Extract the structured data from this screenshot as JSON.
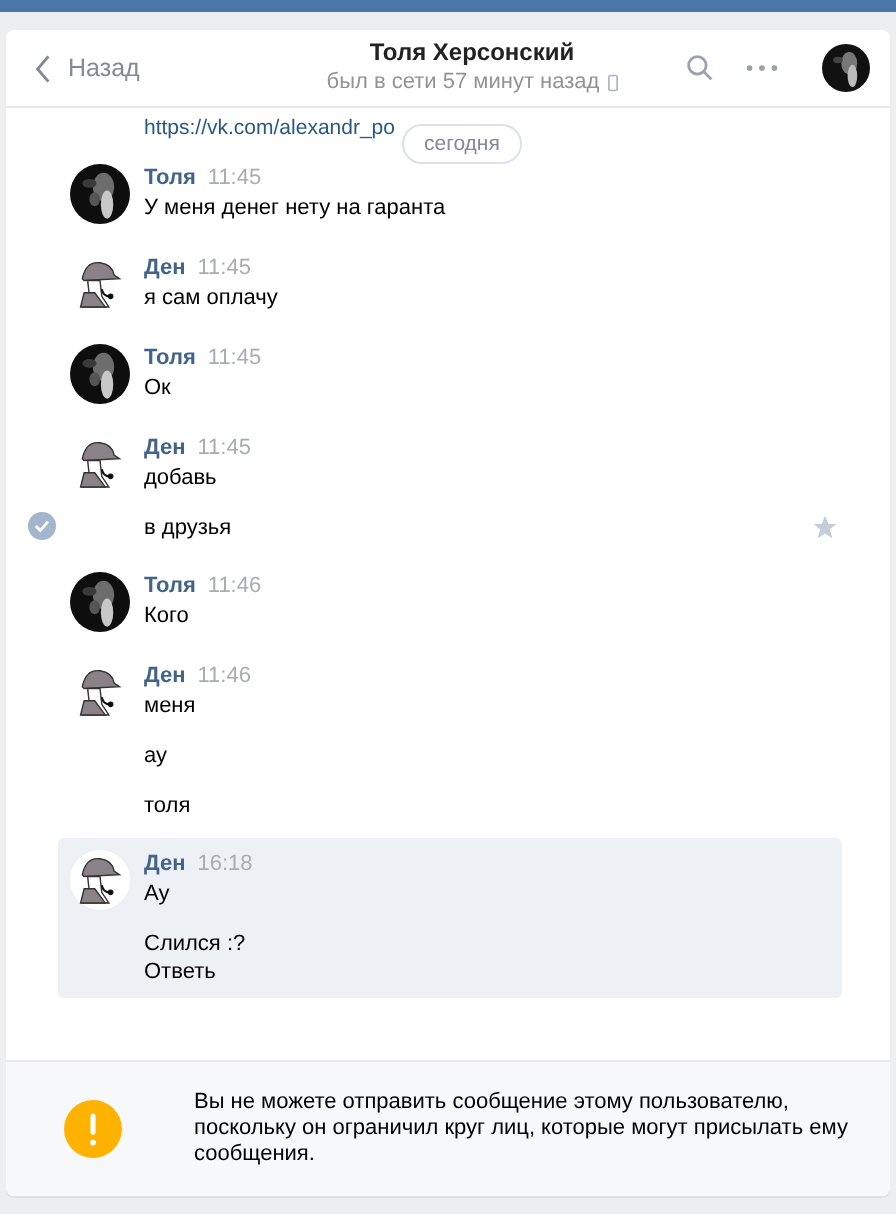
{
  "header": {
    "back": "Назад",
    "title": "Толя Херсонский",
    "status": "был в сети 57 минут назад"
  },
  "link": "https://vk.com/alexandr_po",
  "date_pill": "сегодня",
  "groups": [
    {
      "author": "Толя",
      "time": "11:45",
      "highlighted": false,
      "messages": [
        {
          "text": "У меня денег нету на гаранта",
          "selected": false
        }
      ]
    },
    {
      "author": "Ден",
      "time": "11:45",
      "kind": "detective",
      "highlighted": false,
      "messages": [
        {
          "text": "я сам оплачу",
          "selected": false
        }
      ]
    },
    {
      "author": "Толя",
      "time": "11:45",
      "highlighted": false,
      "messages": [
        {
          "text": "Ок",
          "selected": false
        }
      ]
    },
    {
      "author": "Ден",
      "time": "11:45",
      "kind": "detective",
      "highlighted": false,
      "messages": [
        {
          "text": "добавь",
          "selected": false
        },
        {
          "text": "в друзья",
          "selected": true
        }
      ]
    },
    {
      "author": "Толя",
      "time": "11:46",
      "highlighted": false,
      "messages": [
        {
          "text": "Кого",
          "selected": false
        }
      ]
    },
    {
      "author": "Ден",
      "time": "11:46",
      "kind": "detective",
      "highlighted": false,
      "messages": [
        {
          "text": "меня",
          "selected": false
        },
        {
          "text": "ау",
          "selected": false
        },
        {
          "text": "толя",
          "selected": false
        }
      ]
    },
    {
      "author": "Ден",
      "time": "16:18",
      "kind": "detective",
      "highlighted": true,
      "messages": [
        {
          "text": "Ау",
          "selected": false
        },
        {
          "text": "Слился :?\nОтветь",
          "selected": false
        }
      ]
    }
  ],
  "notice": "Вы не можете отправить сообщение этому пользователю, поскольку он ограничил круг лиц, которые могут присылать ему сообщения."
}
